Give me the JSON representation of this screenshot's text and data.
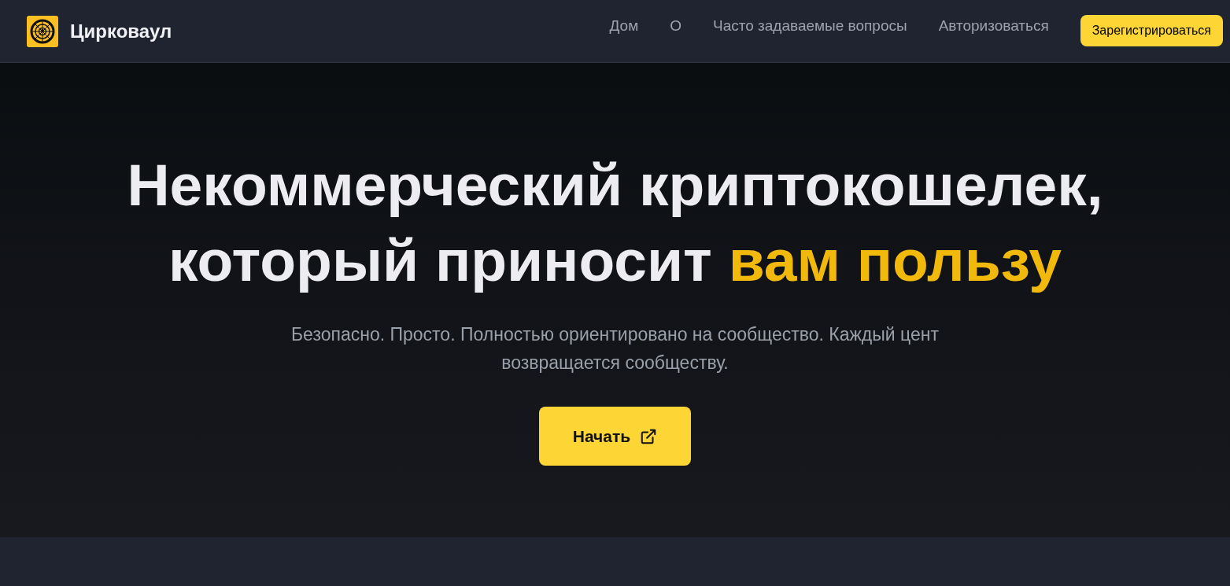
{
  "brand": {
    "name": "Цирковаул"
  },
  "nav": {
    "links": [
      {
        "label": "Дом"
      },
      {
        "label": "О"
      },
      {
        "label": "Часто задаваемые вопросы"
      },
      {
        "label": "Авторизоваться"
      }
    ],
    "cta": "Зарегистрироваться"
  },
  "hero": {
    "headline_line_1": "Некоммерческий криптокошелек,",
    "headline_line_2": "который приносит",
    "headline_highlight": "вам пользу",
    "subtitle": "Безопасно. Просто. Полностью ориентировано на сообщество. Каждый цент возвращается сообществу.",
    "button": "Начать"
  }
}
